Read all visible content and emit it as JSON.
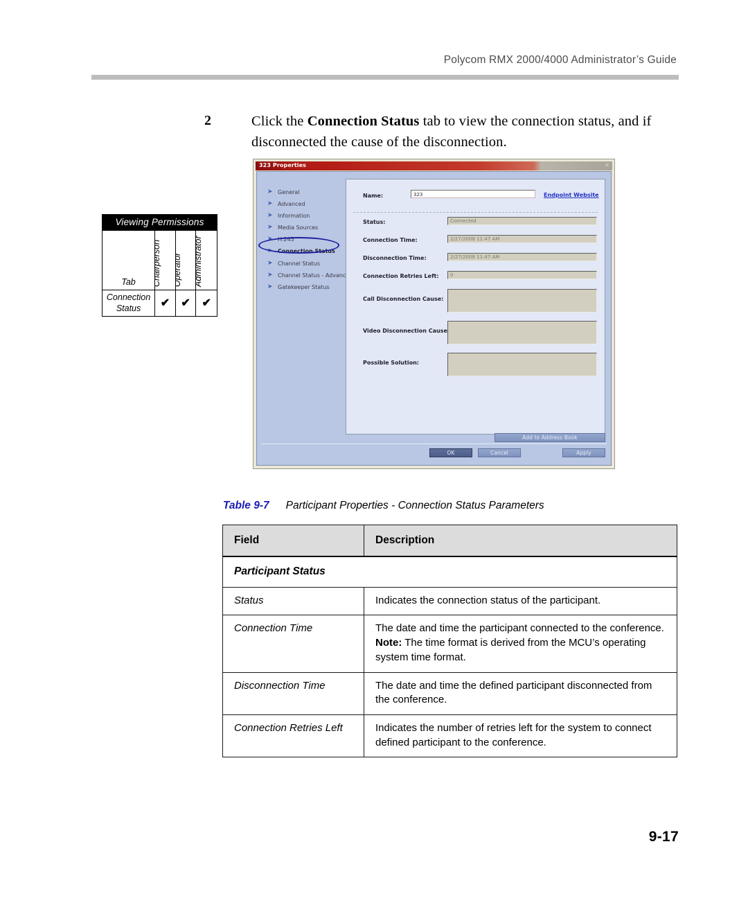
{
  "header": {
    "running_head": "Polycom RMX 2000/4000 Administrator’s Guide"
  },
  "step": {
    "number": "2",
    "text_before": "Click the ",
    "bold_term": "Connection Status",
    "text_after": " tab to view the connection status, and if disconnected the cause of the disconnection."
  },
  "permissions": {
    "title": "Viewing Permissions",
    "columns": [
      "Tab",
      "Chairperson",
      "Operator",
      "Administrator"
    ],
    "rows": [
      {
        "tab": "Connection Status",
        "chairperson": "✔",
        "operator": "✔",
        "administrator": "✔"
      }
    ]
  },
  "dialog": {
    "title": "323 Properties",
    "close_label": "✕",
    "nav_items": [
      {
        "label": "General",
        "selected": false
      },
      {
        "label": "Advanced",
        "selected": false
      },
      {
        "label": "Information",
        "selected": false
      },
      {
        "label": "Media Sources",
        "selected": false
      },
      {
        "label": "H.245",
        "selected": false
      },
      {
        "label": "Connection Status",
        "selected": true
      },
      {
        "label": "Channel Status",
        "selected": false
      },
      {
        "label": "Channel Status - Advanced",
        "selected": false
      },
      {
        "label": "Gatekeeper Status",
        "selected": false
      }
    ],
    "name_label": "Name:",
    "name_value": "323",
    "endpoint_link": "Endpoint Website",
    "fields": [
      {
        "label": "Status:",
        "value": "Connected"
      },
      {
        "label": "Connection Time:",
        "value": "2/27/2008 11:47 AM"
      },
      {
        "label": "Disconnection Time:",
        "value": "2/27/2008 11:47 AM"
      },
      {
        "label": "Connection Retries Left:",
        "value": "0"
      },
      {
        "label": "Call Disconnection Cause:",
        "value": ""
      },
      {
        "label": "Video Disconnection Cause:",
        "value": ""
      },
      {
        "label": "Possible Solution:",
        "value": ""
      }
    ],
    "buttons": {
      "address_book": "Add to Address Book",
      "ok": "OK",
      "cancel": "Cancel",
      "apply": "Apply"
    }
  },
  "table": {
    "caption_number": "Table 9-7",
    "caption_text": "Participant Properties - Connection Status Parameters",
    "headers": [
      "Field",
      "Description"
    ],
    "section_title": "Participant Status",
    "rows": [
      {
        "field": "Status",
        "desc": "Indicates the connection status of the participant."
      },
      {
        "field": "Connection Time",
        "desc_line1": "The date and time the participant connected to the conference.",
        "desc_note_label": "Note:",
        "desc_line2": " The time format is derived from the MCU’s operating system time format."
      },
      {
        "field": "Disconnection Time",
        "desc": "The date and time the defined participant disconnected from the conference."
      },
      {
        "field": "Connection Retries Left",
        "desc": "Indicates the number of retries left for the system to connect defined participant to the conference."
      }
    ]
  },
  "footer": {
    "page_number": "9-17"
  }
}
